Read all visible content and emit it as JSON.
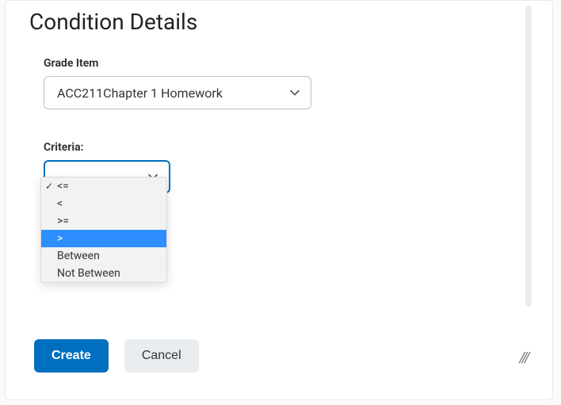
{
  "page": {
    "title": "Condition Details"
  },
  "grade_item": {
    "label": "Grade Item",
    "selected": "ACC211Chapter 1 Homework"
  },
  "criteria": {
    "label": "Criteria:",
    "selected": "<=",
    "options": [
      {
        "label": "<=",
        "checked": true,
        "highlighted": false
      },
      {
        "label": "<",
        "checked": false,
        "highlighted": false
      },
      {
        "label": ">=",
        "checked": false,
        "highlighted": false
      },
      {
        "label": ">",
        "checked": false,
        "highlighted": true
      },
      {
        "label": "Between",
        "checked": false,
        "highlighted": false
      },
      {
        "label": "Not Between",
        "checked": false,
        "highlighted": false
      }
    ]
  },
  "footer": {
    "create_label": "Create",
    "cancel_label": "Cancel"
  }
}
